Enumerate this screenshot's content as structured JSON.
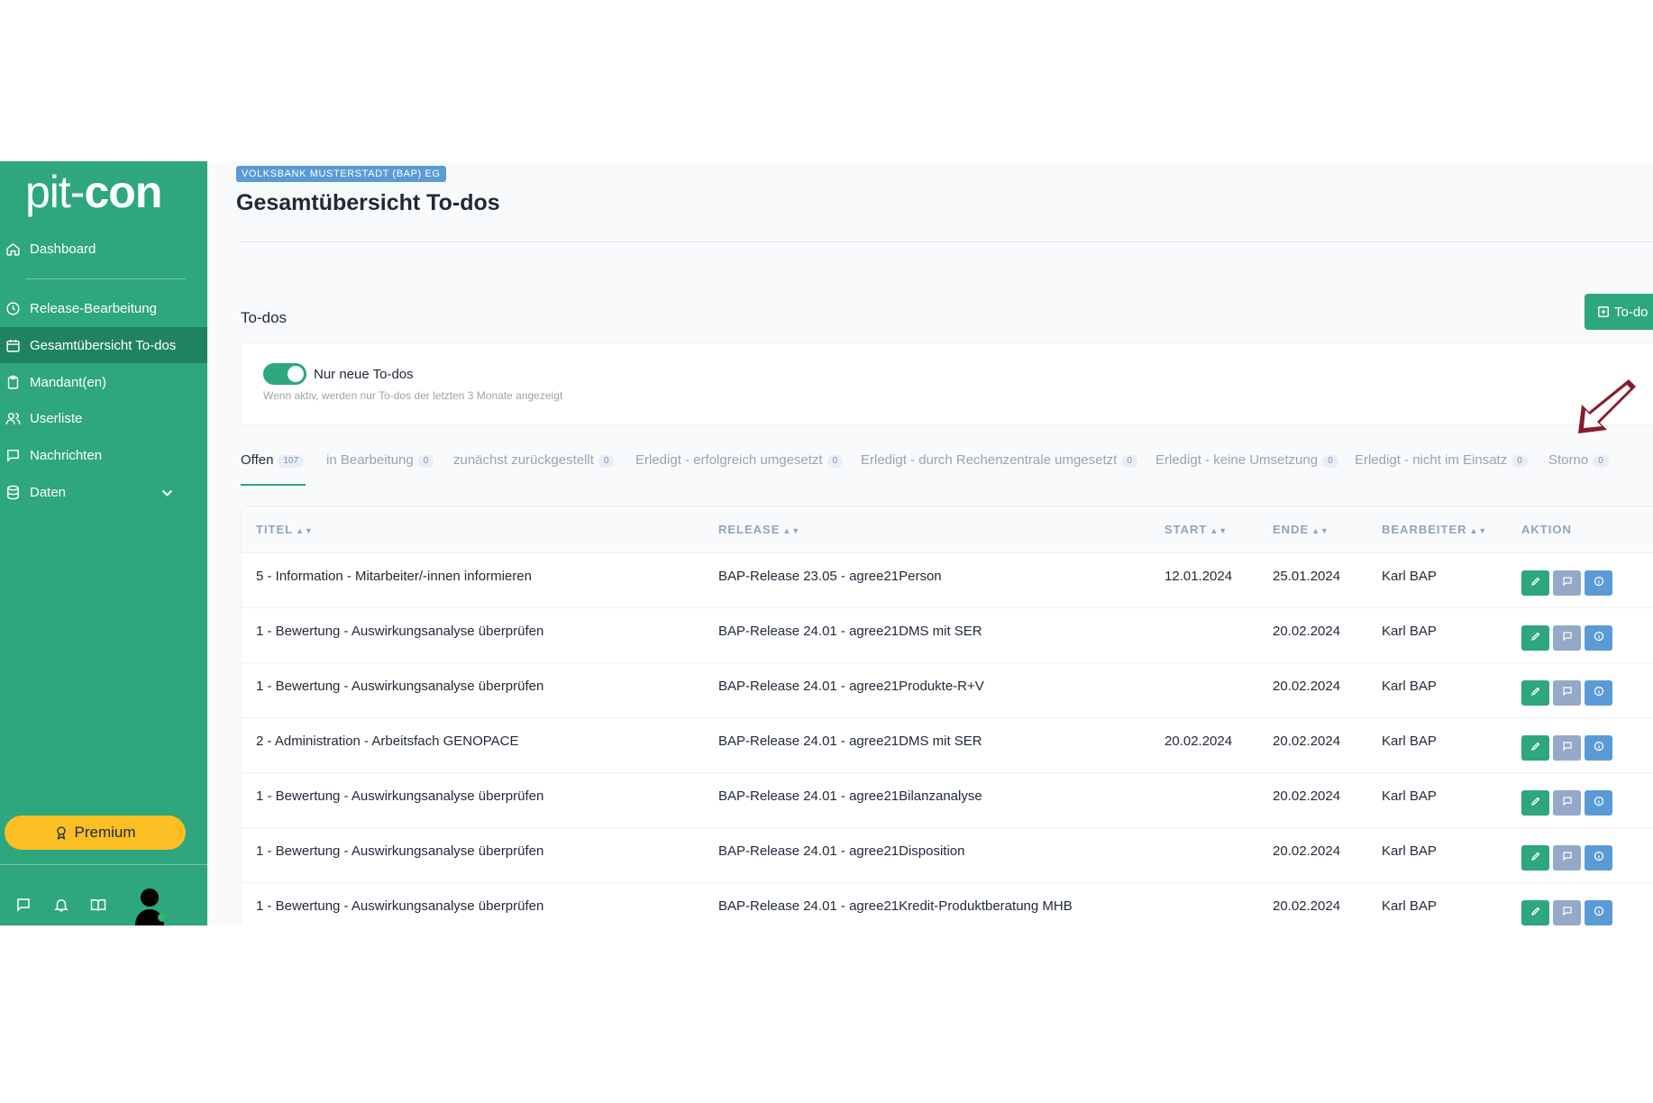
{
  "brand": {
    "part1": "pit-",
    "part2": "con"
  },
  "sidebar": {
    "items": [
      {
        "label": "Dashboard",
        "icon": "home-icon"
      },
      {
        "label": "Release-Bearbeitung",
        "icon": "clock-icon"
      },
      {
        "label": "Gesamtübersicht To-dos",
        "icon": "calendar-icon"
      },
      {
        "label": "Mandant(en)",
        "icon": "clipboard-icon"
      },
      {
        "label": "Userliste",
        "icon": "users-icon"
      },
      {
        "label": "Nachrichten",
        "icon": "message-icon"
      },
      {
        "label": "Daten",
        "icon": "database-icon"
      }
    ],
    "premium_label": "Premium"
  },
  "header": {
    "org_badge": "VOLKSBANK MUSTERSTADT (BAP) EG",
    "title": "Gesamtübersicht To-dos"
  },
  "section": {
    "label": "To-dos",
    "add_button": "To-do"
  },
  "filter": {
    "toggle_label": "Nur neue To-dos",
    "toggle_on": true,
    "hint": "Wenn aktiv, werden nur To-dos der letzten 3 Monate angezeigt"
  },
  "tabs": [
    {
      "label": "Offen",
      "count": "107"
    },
    {
      "label": "in Bearbeitung",
      "count": "0"
    },
    {
      "label": "zunächst zurückgestellt",
      "count": "0"
    },
    {
      "label": "Erledigt - erfolgreich umgesetzt",
      "count": "0"
    },
    {
      "label": "Erledigt - durch Rechenzentrale umgesetzt",
      "count": "0"
    },
    {
      "label": "Erledigt - keine Umsetzung",
      "count": "0"
    },
    {
      "label": "Erledigt - nicht im Einsatz",
      "count": "0"
    },
    {
      "label": "Storno",
      "count": "0"
    }
  ],
  "table": {
    "columns": [
      "TITEL",
      "RELEASE",
      "START",
      "ENDE",
      "BEARBEITER",
      "AKTION"
    ],
    "rows": [
      {
        "titel": "5 - Information - Mitarbeiter/-innen informieren",
        "release": "BAP-Release 23.05 - agree21Person",
        "start": "12.01.2024",
        "ende": "25.01.2024",
        "bearbeiter": "Karl BAP"
      },
      {
        "titel": "1 - Bewertung - Auswirkungsanalyse überprüfen",
        "release": "BAP-Release 24.01 - agree21DMS mit SER",
        "start": "",
        "ende": "20.02.2024",
        "bearbeiter": "Karl BAP"
      },
      {
        "titel": "1 - Bewertung - Auswirkungsanalyse überprüfen",
        "release": "BAP-Release 24.01 - agree21Produkte-R+V",
        "start": "",
        "ende": "20.02.2024",
        "bearbeiter": "Karl BAP"
      },
      {
        "titel": "2 - Administration - Arbeitsfach GENOPACE",
        "release": "BAP-Release 24.01 - agree21DMS mit SER",
        "start": "20.02.2024",
        "ende": "20.02.2024",
        "bearbeiter": "Karl BAP"
      },
      {
        "titel": "1 - Bewertung - Auswirkungsanalyse überprüfen",
        "release": "BAP-Release 24.01 - agree21Bilanzanalyse",
        "start": "",
        "ende": "20.02.2024",
        "bearbeiter": "Karl BAP"
      },
      {
        "titel": "1 - Bewertung - Auswirkungsanalyse überprüfen",
        "release": "BAP-Release 24.01 - agree21Disposition",
        "start": "",
        "ende": "20.02.2024",
        "bearbeiter": "Karl BAP"
      },
      {
        "titel": "1 - Bewertung - Auswirkungsanalyse überprüfen",
        "release": "BAP-Release 24.01 - agree21Kredit-Produktberatung MHB",
        "start": "",
        "ende": "20.02.2024",
        "bearbeiter": "Karl BAP"
      }
    ]
  },
  "colors": {
    "accent": "#2ea67e",
    "accent_dark": "#1f8363",
    "premium": "#fbbf24",
    "badge": "#5b9bd5",
    "arrow": "#8b1a2b"
  }
}
